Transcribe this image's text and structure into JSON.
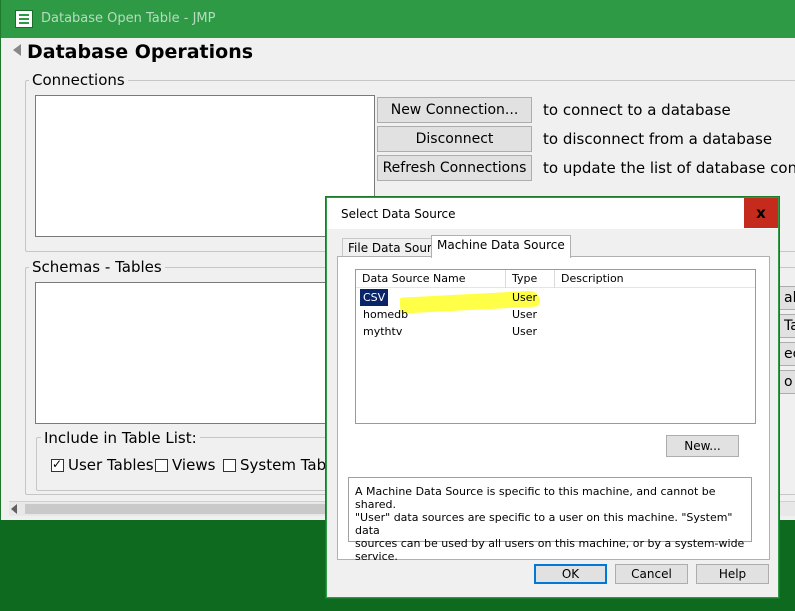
{
  "window": {
    "title": "Database Open Table - JMP",
    "heading": "Database Operations"
  },
  "connections": {
    "label": "Connections",
    "buttons": [
      {
        "label": "New Connection...",
        "description": "to connect to a database"
      },
      {
        "label": "Disconnect",
        "description": "to disconnect from a database"
      },
      {
        "label": "Refresh Connections",
        "description": "to update the list of database connec"
      }
    ]
  },
  "schemas": {
    "label": "Schemas - Tables",
    "include_label": "Include in Table List:",
    "options": [
      {
        "label": "User Tables",
        "checked": true
      },
      {
        "label": "Views",
        "checked": false
      },
      {
        "label": "System Table",
        "checked": false
      }
    ],
    "clipped_buttons": [
      "ab",
      "Ta",
      "ec",
      "o"
    ]
  },
  "dialog": {
    "title": "Select Data Source",
    "close_glyph": "x",
    "tabs": [
      "File Data Source",
      "Machine Data Source"
    ],
    "active_tab": "Machine Data Source",
    "columns": [
      "Data Source Name",
      "Type",
      "Description"
    ],
    "rows": [
      {
        "name": "CSV",
        "type": "User",
        "description": ""
      },
      {
        "name": "homedb",
        "type": "User",
        "description": ""
      },
      {
        "name": "mythtv",
        "type": "User",
        "description": ""
      }
    ],
    "new_button": "New...",
    "info_lines": [
      "A Machine Data Source is specific to this machine, and cannot be shared.",
      "\"User\" data sources are specific to a user on this machine.  \"System\" data",
      "sources can be used by all users on this machine, or by a system-wide service."
    ],
    "ok": "OK",
    "cancel": "Cancel",
    "help": "Help"
  },
  "colors": {
    "titlebar": "#2f9a46",
    "desktop": "#0e6a1e",
    "selection": "#0a246a",
    "highlight": "#ffff33",
    "close": "#c42b1c"
  }
}
